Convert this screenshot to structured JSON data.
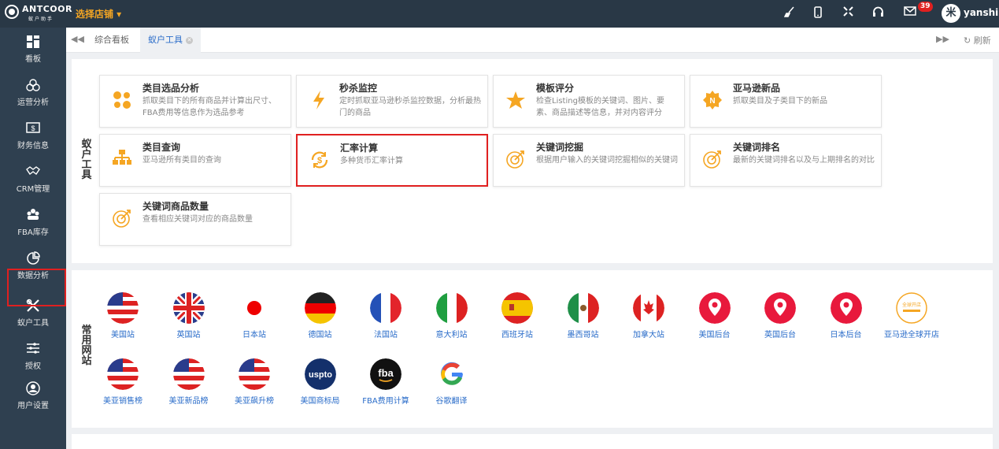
{
  "topbar": {
    "brand": "ANTCOOR",
    "brand_sub": "蚁户助手",
    "store_select": "选择店铺 ▾",
    "mail_badge": "39",
    "user_name": "yanshi",
    "user_avatar": "米"
  },
  "sidebar": {
    "items": [
      {
        "label": "看板",
        "icon": "dashboard-icon"
      },
      {
        "label": "运营分析",
        "icon": "operations-icon"
      },
      {
        "label": "财务信息",
        "icon": "finance-icon"
      },
      {
        "label": "CRM管理",
        "icon": "crm-icon"
      },
      {
        "label": "FBA库存",
        "icon": "inventory-icon"
      },
      {
        "label": "数据分析",
        "icon": "data-analysis-icon"
      },
      {
        "label": "蚁户工具",
        "icon": "tools-icon"
      },
      {
        "label": "授权",
        "icon": "authorize-icon"
      },
      {
        "label": "用户设置",
        "icon": "user-settings-icon"
      }
    ],
    "active_index": 6
  },
  "tabs": {
    "items": [
      {
        "label": "综合看板"
      },
      {
        "label": "蚁户工具"
      }
    ],
    "refresh_label": "刷新"
  },
  "tools_section": {
    "heading": "蚁户工具",
    "cards": [
      {
        "title": "类目选品分析",
        "desc": "抓取类目下的所有商品并计算出尺寸、FBA费用等信息作为选品参考",
        "icon": "category-dots-icon"
      },
      {
        "title": "秒杀监控",
        "desc": "定时抓取亚马逊秒杀监控数据，分析最热门的商品",
        "icon": "lightning-icon"
      },
      {
        "title": "模板评分",
        "desc": "检查Listing模板的关键词、图片、要素、商品描述等信息，并对内容评分",
        "icon": "star-icon"
      },
      {
        "title": "亚马逊新品",
        "desc": "抓取类目及子类目下的新品",
        "icon": "new-badge-icon"
      },
      {
        "title": "类目查询",
        "desc": "亚马逊所有类目的查询",
        "icon": "hierarchy-icon"
      },
      {
        "title": "汇率计算",
        "desc": "多种货币汇率计算",
        "icon": "currency-exchange-icon"
      },
      {
        "title": "关键词挖掘",
        "desc": "根据用户输入的关键词挖掘相似的关键词",
        "icon": "target-icon"
      },
      {
        "title": "关键词排名",
        "desc": "最新的关键词排名以及与上期排名的对比",
        "icon": "target-icon"
      },
      {
        "title": "关键词商品数量",
        "desc": "查看相应关键词对应的商品数量",
        "icon": "target-icon"
      }
    ]
  },
  "sites_section": {
    "heading": "常用网站",
    "sites": [
      {
        "label": "美国站",
        "icon": "us-flag-icon"
      },
      {
        "label": "英国站",
        "icon": "uk-flag-icon"
      },
      {
        "label": "日本站",
        "icon": "japan-flag-icon"
      },
      {
        "label": "德国站",
        "icon": "germany-flag-icon"
      },
      {
        "label": "法国站",
        "icon": "france-flag-icon"
      },
      {
        "label": "意大利站",
        "icon": "italy-flag-icon"
      },
      {
        "label": "西班牙站",
        "icon": "spain-flag-icon"
      },
      {
        "label": "墨西哥站",
        "icon": "mexico-flag-icon"
      },
      {
        "label": "加拿大站",
        "icon": "canada-flag-icon"
      },
      {
        "label": "美国后台",
        "icon": "location-pin-icon"
      },
      {
        "label": "英国后台",
        "icon": "location-pin-icon"
      },
      {
        "label": "日本后台",
        "icon": "location-pin-icon"
      },
      {
        "label": "亚马逊全球开店",
        "icon": "global-selling-icon",
        "icon_text": "全球开店"
      },
      {
        "label": "美亚销售榜",
        "icon": "us-flag-icon"
      },
      {
        "label": "美亚新品榜",
        "icon": "us-flag-icon"
      },
      {
        "label": "美亚飙升榜",
        "icon": "us-flag-icon"
      },
      {
        "label": "美国商标局",
        "icon": "uspto-icon",
        "icon_text": "uspto"
      },
      {
        "label": "FBA费用计算",
        "icon": "fba-icon",
        "icon_text": "fba"
      },
      {
        "label": "谷歌翻译",
        "icon": "google-icon",
        "icon_text": "G"
      }
    ]
  },
  "colors": {
    "topbar": "#293846",
    "sidebar": "#2f4050",
    "accent_orange": "#f5a623",
    "link_blue": "#2a6cc9",
    "highlight_red": "#e02020"
  }
}
